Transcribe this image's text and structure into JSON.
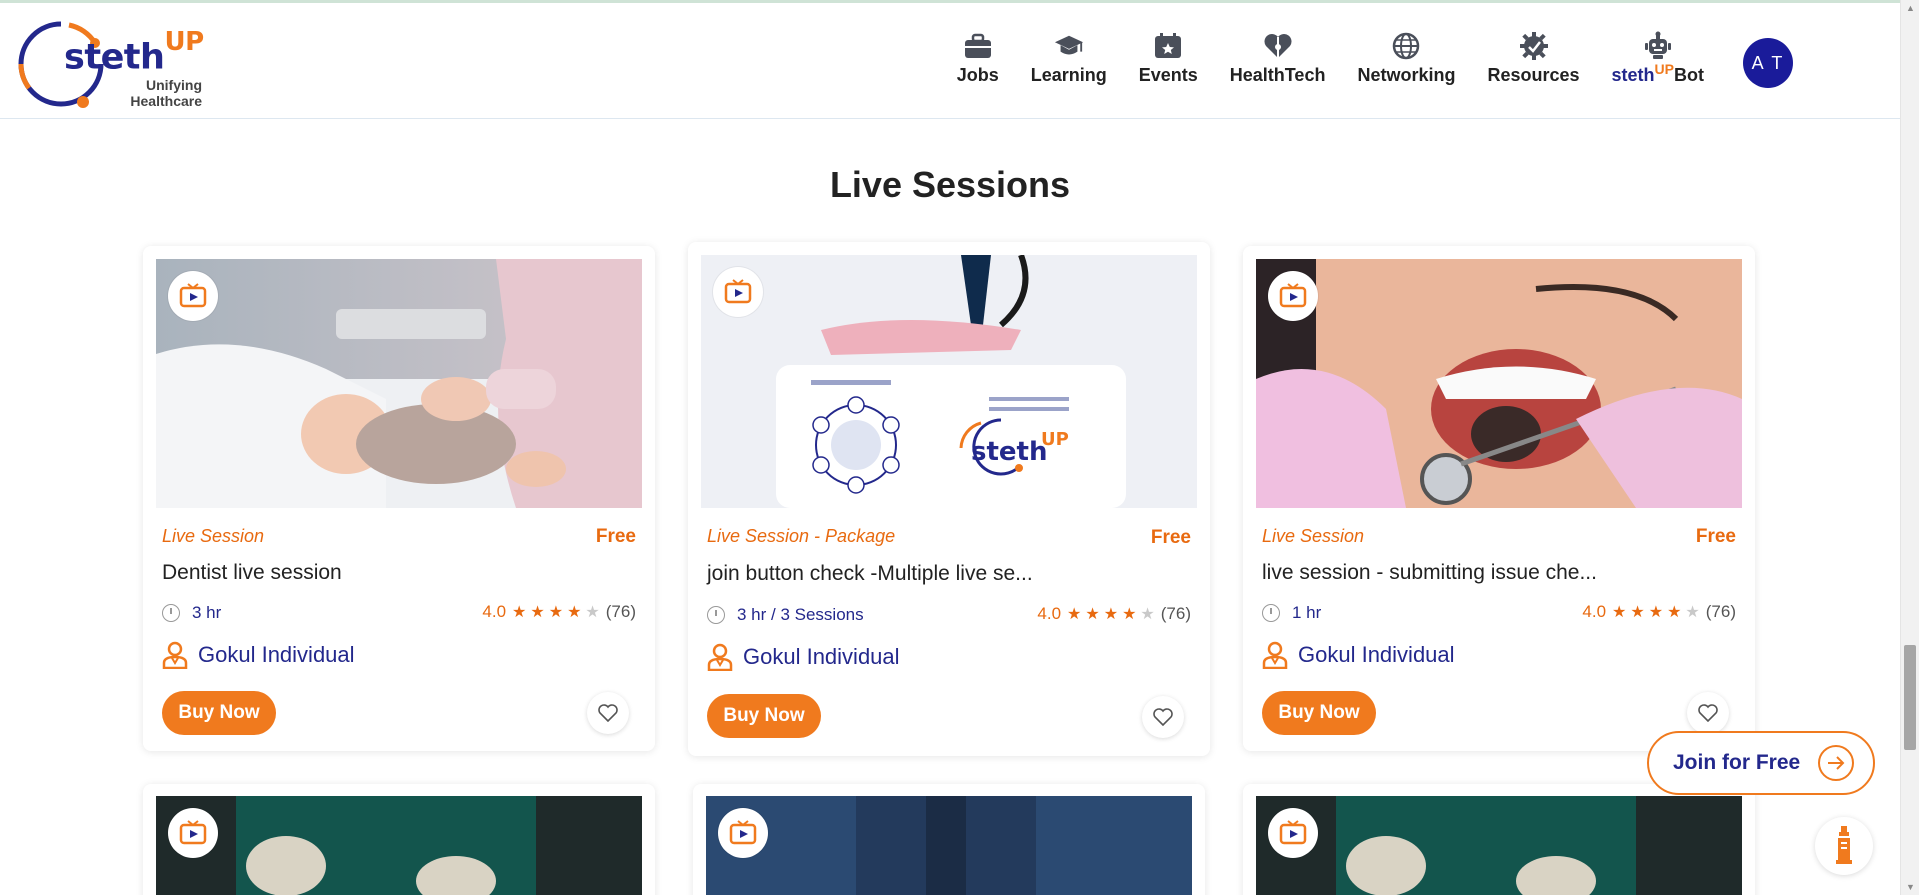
{
  "brand": {
    "name": "steth",
    "name_sup": "UP",
    "tagline_line1": "Unifying",
    "tagline_line2": "Healthcare"
  },
  "nav": {
    "items": [
      {
        "label": "Jobs",
        "icon": "briefcase-icon"
      },
      {
        "label": "Learning",
        "icon": "graduation-cap-icon"
      },
      {
        "label": "Events",
        "icon": "calendar-star-icon"
      },
      {
        "label": "HealthTech",
        "icon": "heart-puzzle-icon"
      },
      {
        "label": "Networking",
        "icon": "globe-icon"
      },
      {
        "label": "Resources",
        "icon": "gear-icon"
      }
    ],
    "bot": {
      "steth": "steth",
      "up": "UP",
      "bot": "Bot",
      "icon": "robot-icon"
    },
    "avatar_initials": "A T"
  },
  "section": {
    "title": "Live Sessions"
  },
  "cards": [
    {
      "type": "Live Session",
      "price": "Free",
      "title": "Dentist live session",
      "duration": "3 hr",
      "rating": "4.0",
      "stars": 4,
      "count": "(76)",
      "author": "Gokul Individual",
      "cta": "Buy Now"
    },
    {
      "type": "Live Session - Package",
      "price": "Free",
      "title": "join button check -Multiple live se...",
      "duration": "3 hr / 3 Sessions",
      "rating": "4.0",
      "stars": 4,
      "count": "(76)",
      "author": "Gokul Individual",
      "cta": "Buy Now"
    },
    {
      "type": "Live Session",
      "price": "Free",
      "title": "live session - submitting issue che...",
      "duration": "1 hr",
      "rating": "4.0",
      "stars": 4,
      "count": "(76)",
      "author": "Gokul Individual",
      "cta": "Buy Now"
    }
  ],
  "floating": {
    "join_label": "Join for Free"
  },
  "colors": {
    "brand_blue": "#23288c",
    "brand_orange": "#f07a1e",
    "avatar": "#1a1b9a"
  }
}
